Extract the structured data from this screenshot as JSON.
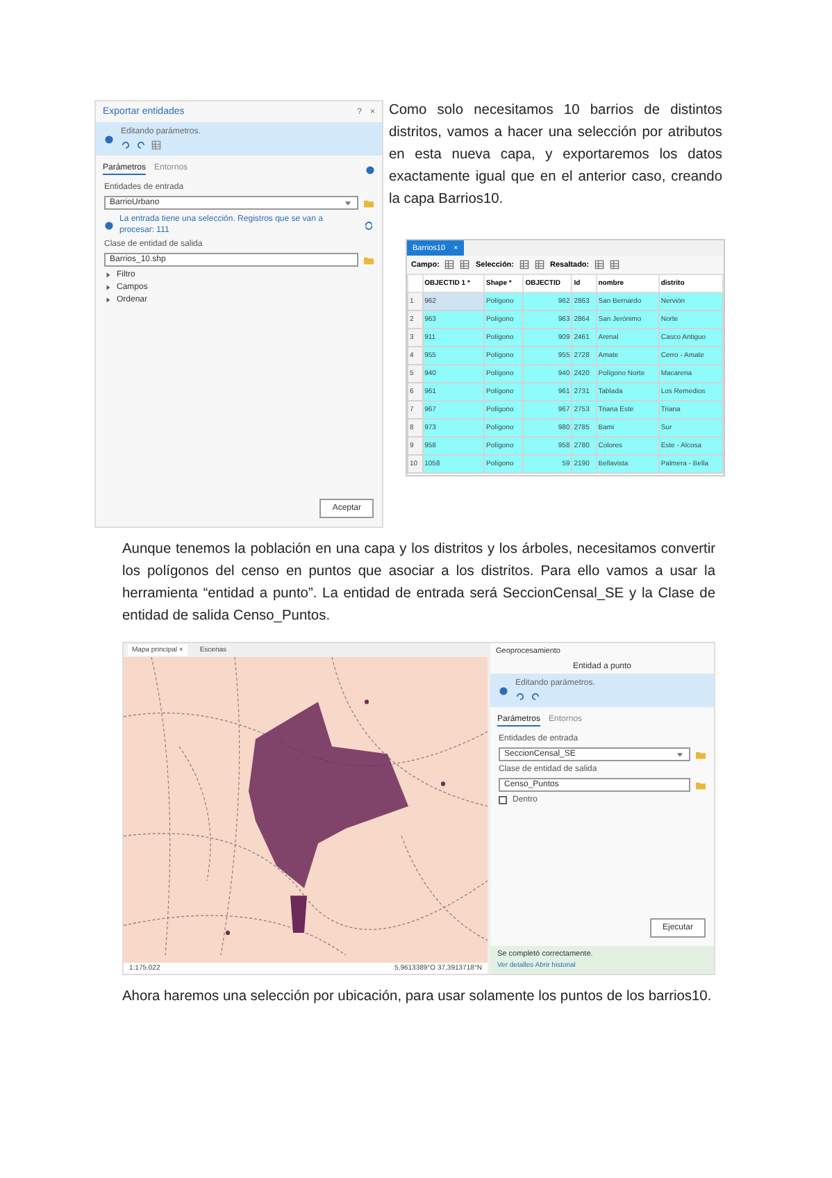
{
  "export_panel": {
    "title": "Exportar entidades",
    "help": "?",
    "close": "×",
    "info_text": "Editando parámetros.",
    "tabs": [
      {
        "label": "Parámetros",
        "selected": true
      },
      {
        "label": "Entornos",
        "selected": false
      }
    ],
    "input_label": "Entidades de entrada",
    "input_value": "BarrioUrbano",
    "warning": "La entrada tiene una selección. Registros que se van a procesar: 111",
    "output_label": "Clase de entidad de salida",
    "output_value": "Barrios_10.shp",
    "sections": [
      {
        "label": "Filtro",
        "expanded": false
      },
      {
        "label": "Campos",
        "expanded": false
      },
      {
        "label": "Ordenar",
        "expanded": false
      }
    ],
    "ok_button": "Aceptar"
  },
  "intro_text": "Como solo necesitamos 10 barrios de distintos distritos, vamos a hacer una selección por atributos en esta nueva capa, y exportaremos los datos exactamente igual que en el anterior caso, creando la capa Barrios10.",
  "table": {
    "tab_title": "Barrios10",
    "close": "×",
    "toolbar": [
      "Campo:",
      "Selección:",
      "Resaltado:"
    ],
    "columns": [
      "OBJECTID 1 *",
      "Shape *",
      "OBJECTID",
      "Id",
      "nombre",
      "distrito"
    ],
    "rows": [
      {
        "number": "1",
        "selected": true,
        "cells": [
          "962",
          "Polígono",
          "962",
          "2863",
          "San Bernardo",
          "Nervión"
        ]
      },
      {
        "number": "2",
        "selected": false,
        "cells": [
          "963",
          "Polígono",
          "963",
          "2864",
          "San Jerónimo",
          "Norte"
        ]
      },
      {
        "number": "3",
        "selected": false,
        "cells": [
          "911",
          "Polígono",
          "909",
          "2461",
          "Arenal",
          "Casco Antiguo"
        ]
      },
      {
        "number": "4",
        "selected": false,
        "cells": [
          "955",
          "Polígono",
          "955",
          "2728",
          "Amate",
          "Cerro - Amate"
        ]
      },
      {
        "number": "5",
        "selected": false,
        "cells": [
          "940",
          "Polígono",
          "940",
          "2420",
          "Polígono Norte",
          "Macarena"
        ]
      },
      {
        "number": "6",
        "selected": false,
        "cells": [
          "961",
          "Polígono",
          "961",
          "2731",
          "Tablada",
          "Los Remedios"
        ]
      },
      {
        "number": "7",
        "selected": false,
        "cells": [
          "967",
          "Polígono",
          "967",
          "2753",
          "Triana Este",
          "Triana"
        ]
      },
      {
        "number": "8",
        "selected": false,
        "cells": [
          "973",
          "Polígono",
          "980",
          "2785",
          "Bami",
          "Sur"
        ]
      },
      {
        "number": "9",
        "selected": false,
        "cells": [
          "958",
          "Polígono",
          "958",
          "2780",
          "Colores",
          "Este - Alcosa"
        ]
      },
      {
        "number": "10",
        "selected": false,
        "cells": [
          "1058",
          "Polígono",
          "59",
          "2190",
          "Bellavista",
          "Palmera - Bella"
        ]
      }
    ]
  },
  "paragraph_2": "Aunque tenemos la población en una capa y los distritos y los árboles, necesitamos convertir los polígonos del censo en puntos que asociar a los distritos. Para ello vamos a usar la herramienta “entidad a punto”. La entidad de entrada será SeccionCensal_SE y la Clase de entidad de salida Censo_Puntos.",
  "map_window": {
    "tabs": [
      {
        "label": "Mapa principal",
        "selected": true
      },
      {
        "label": "Escenas",
        "selected": false
      }
    ],
    "close": "×",
    "scale": "1:175.022",
    "coordinates": "5,9613389°O 37,3913718°N"
  },
  "geoprocessing": {
    "title": "Geoprocesamiento",
    "tool_name": "Entidad a punto",
    "info_text": "Editando parámetros.",
    "tabs": [
      {
        "label": "Parámetros",
        "selected": true
      },
      {
        "label": "Entornos",
        "selected": false
      }
    ],
    "input_label": "Entidades de entrada",
    "input_value": "SeccionCensal_SE",
    "output_label": "Clase de entidad de salida",
    "output_value": "Censo_Puntos",
    "inside": {
      "label": "Dentro",
      "checked": false
    },
    "run_button": "Ejecutar",
    "success": "Se completó correctamente.",
    "details_link": "Ver detalles  Abrir historial"
  },
  "paragraph_3": "Ahora haremos una selección por ubicación, para usar solamente los puntos de los barrios10."
}
